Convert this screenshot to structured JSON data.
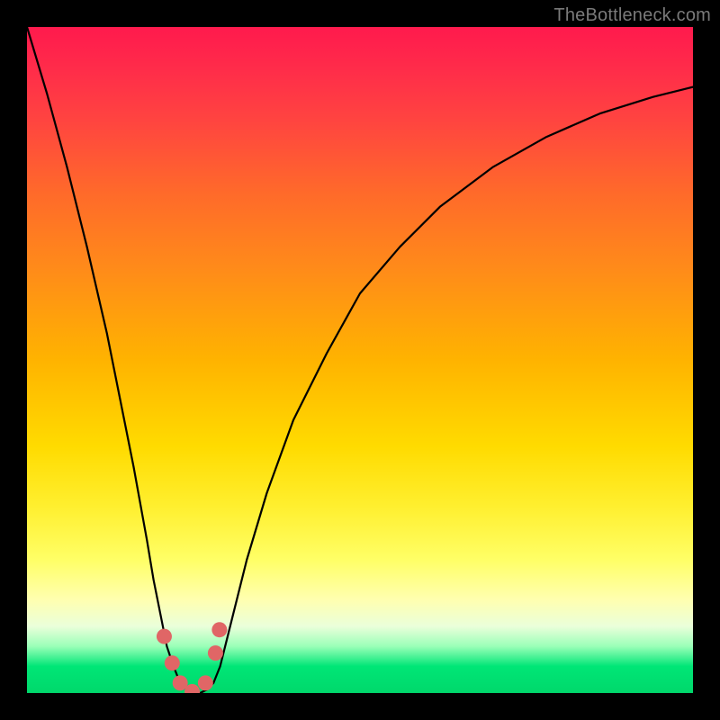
{
  "watermark": "TheBottleneck.com",
  "chart_data": {
    "type": "line",
    "title": "",
    "xlabel": "",
    "ylabel": "",
    "xlim": [
      0,
      100
    ],
    "ylim": [
      0,
      100
    ],
    "x": [
      0,
      3,
      6,
      9,
      12,
      14,
      16,
      18,
      19,
      20,
      21,
      22,
      23,
      24,
      25,
      26,
      27,
      28,
      29,
      30,
      31,
      33,
      36,
      40,
      45,
      50,
      56,
      62,
      70,
      78,
      86,
      94,
      100
    ],
    "y": [
      100,
      90,
      79,
      67,
      54,
      44,
      34,
      23,
      17,
      12,
      7,
      4,
      1.5,
      0.5,
      0,
      0,
      0.5,
      1.5,
      4,
      8,
      12,
      20,
      30,
      41,
      51,
      60,
      67,
      73,
      79,
      83.5,
      87,
      89.5,
      91
    ],
    "markers": {
      "x": [
        20.6,
        21.8,
        23.0,
        24.8,
        26.8,
        28.3,
        28.9
      ],
      "y": [
        8.5,
        4.5,
        1.5,
        0.2,
        1.5,
        6.0,
        9.5
      ],
      "color": "#e06666"
    },
    "line_color": "#000000",
    "line_width": 2.2,
    "background_gradient": {
      "top": "#ff1a4d",
      "mid": "#ffdb00",
      "bottom": "#00d86b"
    },
    "bottom_band": {
      "start_y": 86,
      "colors": [
        "#ffffb0",
        "#eaffda",
        "#9affb8",
        "#00e676",
        "#00d86b"
      ]
    }
  }
}
